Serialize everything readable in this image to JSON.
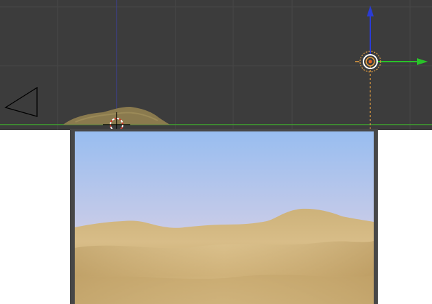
{
  "viewport": {
    "background": "#3c3c3c",
    "grid_color": "#444444",
    "x_axis_color": "#3a9a2e",
    "z_axis_color": "#2a3aa0",
    "objects": [
      {
        "name": "camera",
        "icon": "camera-icon"
      },
      {
        "name": "terrain",
        "icon": "terrain-mesh"
      },
      {
        "name": "3d-cursor",
        "icon": "cursor-icon"
      },
      {
        "name": "sun-lamp",
        "icon": "lamp-icon"
      },
      {
        "name": "transform-gizmo",
        "icon": "gizmo-icon"
      }
    ]
  },
  "render": {
    "frame_color": "#474747",
    "sky_top": "#9dc1f0",
    "sky_bottom": "#d6cfe0",
    "sand_light": "#d9bf8a",
    "sand_dark": "#b8995f"
  }
}
